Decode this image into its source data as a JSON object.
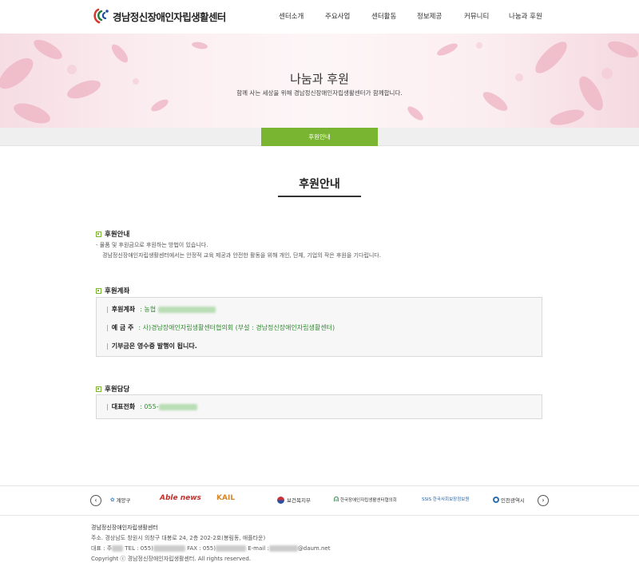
{
  "header": {
    "logo_text": "경남정신장애인자립생활센터",
    "nav": [
      "센터소개",
      "주요사업",
      "센터활동",
      "정보제공",
      "커뮤니티",
      "나눔과 후원"
    ]
  },
  "banner": {
    "title": "나눔과 후원",
    "subtitle": "함께 사는 세상을 위해 경남정신장애인자립생활센터가 함께합니다."
  },
  "subnav": {
    "active_tab": "후원안내"
  },
  "page": {
    "heading": "후원안내",
    "sections": {
      "info": {
        "title": "후원안내",
        "line1": "- 물품 및 후원금으로 후원하는 방법이 있습니다.",
        "line2": "경남정신장애인자립생활센터에서는 안정적 교육 제공과 안전한 활동을 위해 개인, 단체, 기업의 작은 후원을 기다립니다."
      },
      "account": {
        "title": "후원계좌",
        "account_label": "후원계좌",
        "account_value": ": 농협",
        "holder_label": "예 금 주",
        "holder_value": ": 사)경남장애인자립생활센터협의회 (부설 : 경남정신장애인자립생활센터)",
        "receipt_note": "기부금은 영수증 발행이 됩니다."
      },
      "contact": {
        "title": "후원담당",
        "phone_label": "대표전화",
        "phone_value": ": 055-"
      }
    }
  },
  "partners": {
    "prev": "‹",
    "next": "›",
    "logos": [
      "계양구",
      "Able news",
      "KAIL",
      "보건복지부",
      "한국장애인자립생활센터협의회",
      "SSIS 한국사회보장정보원",
      "인천광역시"
    ]
  },
  "footer": {
    "org": "경남정신장애인자립생활센터",
    "address": "주소. 경상남도 창원시 의창구 대봉로 24, 2층 202-2호(봉림동, 애플타운)",
    "contact_prefix": "대표 : 주",
    "tel": "TEL : 055)",
    "fax": "FAX : 055)",
    "email": "E-mail :",
    "email_domain": "@daum.net",
    "copyright": "Copyright ⓒ 경남정신장애인자립생활센터. All rights reserved."
  },
  "colors": {
    "accent": "#7ab532",
    "account_text": "#2e8b2e"
  }
}
